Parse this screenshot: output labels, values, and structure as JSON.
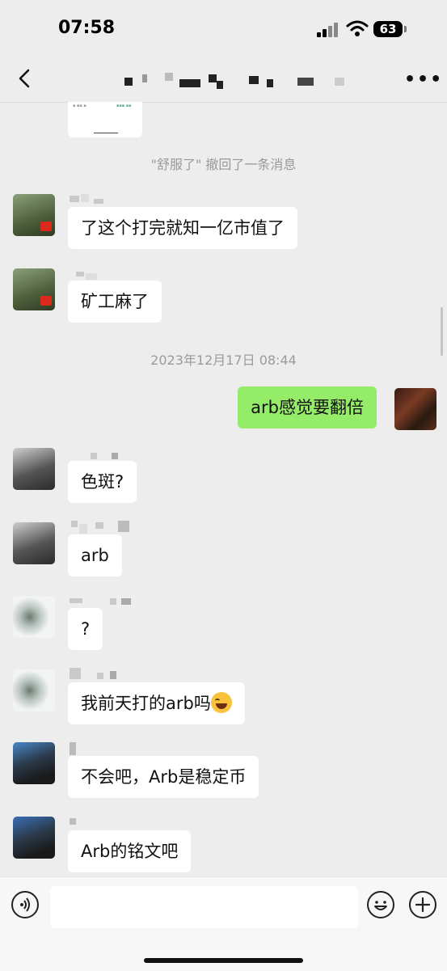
{
  "status_bar": {
    "time": "07:58",
    "battery": "63"
  },
  "header": {
    "title": ""
  },
  "system": {
    "recall_notice": "\"舒服了\" 撤回了一条消息",
    "timestamp": "2023年12月17日 08:44"
  },
  "messages": [
    {
      "text": "了这个打完就知一亿市值了"
    },
    {
      "text": "矿工麻了"
    },
    {
      "text": "arb感觉要翻倍"
    },
    {
      "text": "色斑?"
    },
    {
      "text": "arb"
    },
    {
      "text": "?"
    },
    {
      "text": "我前天打的arb吗"
    },
    {
      "text": "不会吧，Arb是稳定币"
    },
    {
      "text": "Arb的铭文吧"
    }
  ],
  "input": {
    "placeholder": ""
  },
  "colors": {
    "self_bubble": "#95ec69",
    "other_bubble": "#ffffff",
    "background": "#ededed"
  }
}
